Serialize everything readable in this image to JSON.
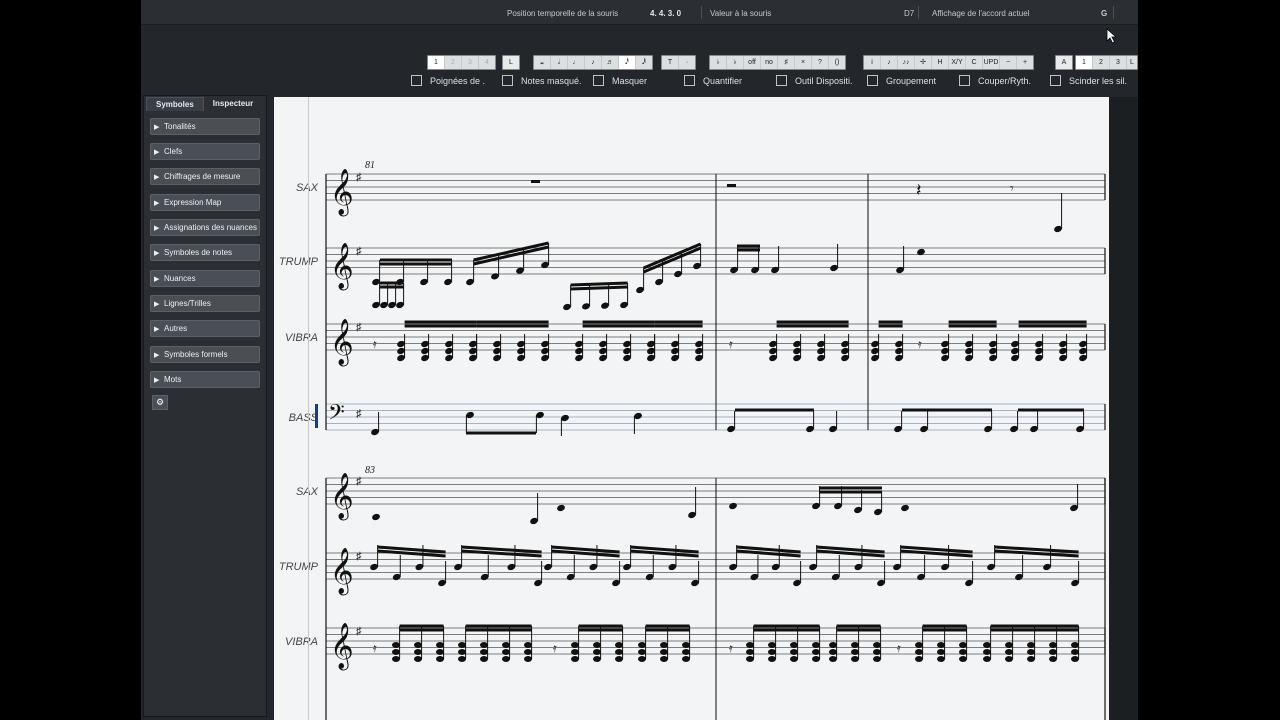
{
  "status": {
    "mouse_pos_label": "Position temporelle de la souris",
    "mouse_pos_value": "4.  4.  3.    0",
    "mouse_value_label": "Valeur à la souris",
    "chord_value": "D7",
    "chord_label": "Affichage de l'accord actuel",
    "key_value": "G"
  },
  "toolbar": {
    "voices": [
      "1",
      "2",
      "3",
      "4"
    ],
    "l_button": "L",
    "note_values": [
      "𝅜",
      "𝅗𝅥",
      "♩",
      "♪",
      "♬",
      "𝅘𝅥𝅰",
      "𝅘𝅥𝅱"
    ],
    "dot_buttons": [
      "T",
      "·"
    ],
    "accidentals": [
      "♭",
      "♭",
      "off",
      "no",
      "♯",
      "×",
      "?",
      "()"
    ],
    "tools": [
      "i",
      "♪",
      "♪♪",
      "✢",
      "H",
      "X/Y",
      "C",
      "UPD",
      "−",
      "+"
    ],
    "a_button": "A",
    "pages": [
      "1",
      "2",
      "3",
      "L"
    ]
  },
  "checks": [
    "Poignées de .",
    "Notes masqué.",
    "Masquer",
    "Quantifier",
    "Outil Dispositi.",
    "Groupement",
    "Couper/Ryth.",
    "Scinder les sil."
  ],
  "panel": {
    "tab_symbols": "Symboles",
    "tab_inspector": "Inspecteur",
    "sections": [
      "Tonalités",
      "Clefs",
      "Chiffrages de mesure",
      "Expression Map",
      "Assignations des nuances",
      "Symboles de notes",
      "Nuances",
      "Lignes/Trilles",
      "Autres",
      "Symboles formels",
      "Mots"
    ]
  },
  "score": {
    "instruments": [
      "SAX",
      "TRUMP",
      "VIBRA",
      "BASS",
      "SAX",
      "TRUMP",
      "VIBRA"
    ],
    "measure_numbers": [
      "81",
      "83"
    ]
  },
  "colors": {
    "accent": "#1e3a8a",
    "panel": "#2b2f34"
  }
}
